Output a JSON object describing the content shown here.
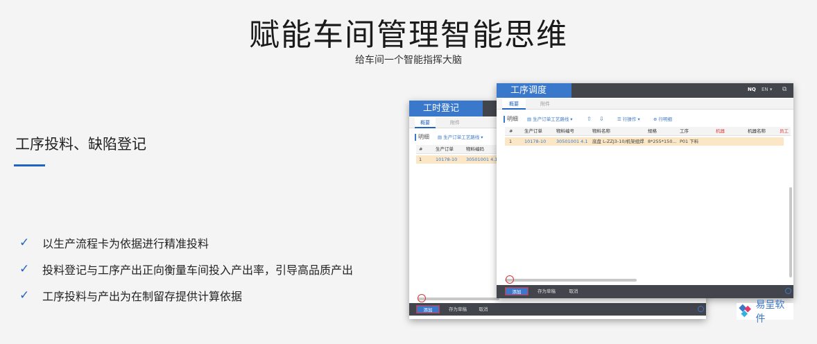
{
  "header": {
    "title": "赋能车间管理智能思维",
    "subtitle": "给车间一个智能指挥大脑"
  },
  "section": {
    "title": "工序投料、缺陷登记",
    "bullets": [
      "以生产流程卡为依据进行精准投料",
      "投料登记与工序产出正向衡量车间投入产出率，引导高品质产出",
      "工序投料与产出为在制留存提供计算依据"
    ]
  },
  "window_back": {
    "title": "工时登记",
    "tabs": [
      "概要",
      "附件"
    ],
    "toolbar": {
      "section": "明细",
      "source": "生产订单工艺路线"
    },
    "columns": [
      "#",
      "生产订单",
      "物料编码"
    ],
    "rows": [
      [
        "1",
        "10178-10",
        "30501001 4.1"
      ]
    ],
    "buttons": {
      "add": "添加",
      "draft": "存为草稿",
      "cancel": "取消"
    }
  },
  "window_front": {
    "title": "工序调度",
    "header_right": {
      "user": "NQ",
      "lang": "EN"
    },
    "tabs": [
      "概要",
      "附件"
    ],
    "toolbar": {
      "section": "明细",
      "source": "生产订单工艺路线",
      "row_ops": "行操作",
      "row_detail": "行明细"
    },
    "columns": [
      "#",
      "生产订单",
      "物料编号",
      "物料名称",
      "规格",
      "工序",
      "机器",
      "机器名称",
      "员工"
    ],
    "rows": [
      [
        "1",
        "10178-10",
        "30501001 4.1",
        "底盘 L-ZZJ3-10/机架组焊",
        "8*255*150...",
        "P01 下料"
      ]
    ],
    "buttons": {
      "add": "添加",
      "draft": "存为草稿",
      "cancel": "取消"
    }
  },
  "logo": {
    "text": "易呈软件"
  },
  "colors": {
    "accent": "#1f64c2",
    "dark_bar": "#42464c",
    "highlight": "#fbe7c6",
    "alert": "#e03030"
  }
}
